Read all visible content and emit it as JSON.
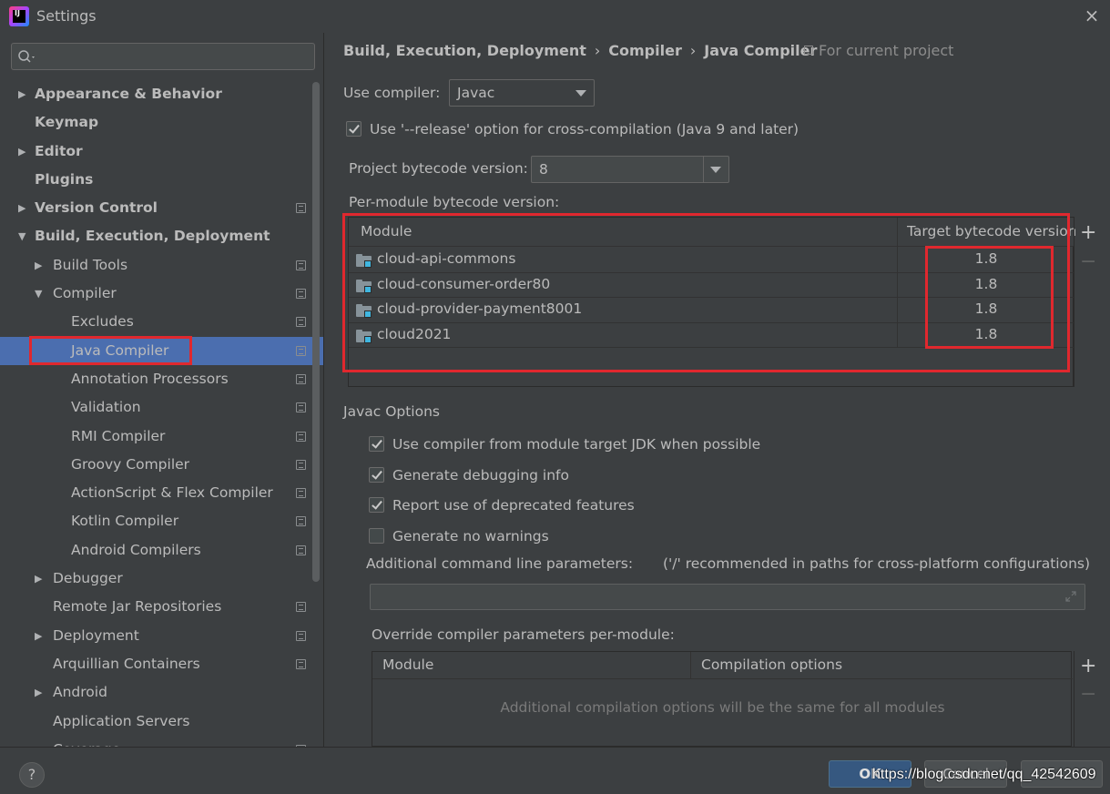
{
  "window": {
    "title": "Settings",
    "close_symbol": "×",
    "logo_text": "IJ"
  },
  "search": {
    "placeholder": ""
  },
  "sidebar": {
    "items": [
      {
        "label": "Appearance & Behavior",
        "level": 0,
        "arrow": "▶",
        "bold": true,
        "project_icon": false
      },
      {
        "label": "Keymap",
        "level": 0,
        "arrow": "",
        "bold": true,
        "project_icon": false
      },
      {
        "label": "Editor",
        "level": 0,
        "arrow": "▶",
        "bold": true,
        "project_icon": false
      },
      {
        "label": "Plugins",
        "level": 0,
        "arrow": "",
        "bold": true,
        "project_icon": false
      },
      {
        "label": "Version Control",
        "level": 0,
        "arrow": "▶",
        "bold": true,
        "project_icon": true
      },
      {
        "label": "Build, Execution, Deployment",
        "level": 0,
        "arrow": "▼",
        "bold": true,
        "project_icon": false
      },
      {
        "label": "Build Tools",
        "level": 1,
        "arrow": "▶",
        "bold": false,
        "project_icon": true
      },
      {
        "label": "Compiler",
        "level": 1,
        "arrow": "▼",
        "bold": false,
        "project_icon": true
      },
      {
        "label": "Excludes",
        "level": 2,
        "arrow": "",
        "bold": false,
        "project_icon": true
      },
      {
        "label": "Java Compiler",
        "level": 2,
        "arrow": "",
        "bold": false,
        "project_icon": true,
        "selected": true
      },
      {
        "label": "Annotation Processors",
        "level": 2,
        "arrow": "",
        "bold": false,
        "project_icon": true
      },
      {
        "label": "Validation",
        "level": 2,
        "arrow": "",
        "bold": false,
        "project_icon": true
      },
      {
        "label": "RMI Compiler",
        "level": 2,
        "arrow": "",
        "bold": false,
        "project_icon": true
      },
      {
        "label": "Groovy Compiler",
        "level": 2,
        "arrow": "",
        "bold": false,
        "project_icon": true
      },
      {
        "label": "ActionScript & Flex Compiler",
        "level": 2,
        "arrow": "",
        "bold": false,
        "project_icon": true
      },
      {
        "label": "Kotlin Compiler",
        "level": 2,
        "arrow": "",
        "bold": false,
        "project_icon": true
      },
      {
        "label": "Android Compilers",
        "level": 2,
        "arrow": "",
        "bold": false,
        "project_icon": true
      },
      {
        "label": "Debugger",
        "level": 1,
        "arrow": "▶",
        "bold": false,
        "project_icon": false
      },
      {
        "label": "Remote Jar Repositories",
        "level": 1,
        "arrow": "",
        "bold": false,
        "project_icon": true
      },
      {
        "label": "Deployment",
        "level": 1,
        "arrow": "▶",
        "bold": false,
        "project_icon": true
      },
      {
        "label": "Arquillian Containers",
        "level": 1,
        "arrow": "",
        "bold": false,
        "project_icon": true
      },
      {
        "label": "Android",
        "level": 1,
        "arrow": "▶",
        "bold": false,
        "project_icon": false
      },
      {
        "label": "Application Servers",
        "level": 1,
        "arrow": "",
        "bold": false,
        "project_icon": false
      },
      {
        "label": "Coverage",
        "level": 1,
        "arrow": "",
        "bold": false,
        "project_icon": true
      }
    ]
  },
  "breadcrumb": {
    "parts": [
      "Build, Execution, Deployment",
      "Compiler",
      "Java Compiler"
    ],
    "separator": "›",
    "scope": "For current project"
  },
  "compiler": {
    "use_compiler_label": "Use compiler:",
    "use_compiler_value": "Javac",
    "release_option_label": "Use '--release' option for cross-compilation (Java 9 and later)",
    "release_option_checked": true,
    "project_bytecode_label": "Project bytecode version:",
    "project_bytecode_value": "8",
    "per_module_label": "Per-module bytecode version:"
  },
  "module_table": {
    "columns": [
      "Module",
      "Target bytecode version"
    ],
    "rows": [
      {
        "module": "cloud-api-commons",
        "version": "1.8"
      },
      {
        "module": "cloud-consumer-order80",
        "version": "1.8"
      },
      {
        "module": "cloud-provider-payment8001",
        "version": "1.8"
      },
      {
        "module": "cloud2021",
        "version": "1.8"
      }
    ],
    "add_symbol": "+",
    "remove_symbol": "−"
  },
  "javac_options": {
    "section_title": "Javac Options",
    "checkboxes": [
      {
        "label": "Use compiler from module target JDK when possible",
        "checked": true
      },
      {
        "label": "Generate debugging info",
        "checked": true
      },
      {
        "label": "Report use of deprecated features",
        "checked": true
      },
      {
        "label": "Generate no warnings",
        "checked": false
      }
    ],
    "additional_params_label": "Additional command line parameters:",
    "additional_params_hint": "('/' recommended in paths for cross-platform configurations)",
    "additional_params_value": "",
    "override_label": "Override compiler parameters per-module:",
    "override_columns": [
      "Module",
      "Compilation options"
    ],
    "override_empty_text": "Additional compilation options will be the same for all modules"
  },
  "footer": {
    "help_label": "?",
    "ok_label": "OK",
    "cancel_label": "Cancel",
    "watermark": "https://blog.csdn.net/qq_42542609"
  },
  "colors": {
    "background": "#3c3f41",
    "selection": "#4b6eaf",
    "highlight_box": "#e0282e",
    "ok_button": "#365880",
    "module_icon_accent": "#40b6e0"
  }
}
